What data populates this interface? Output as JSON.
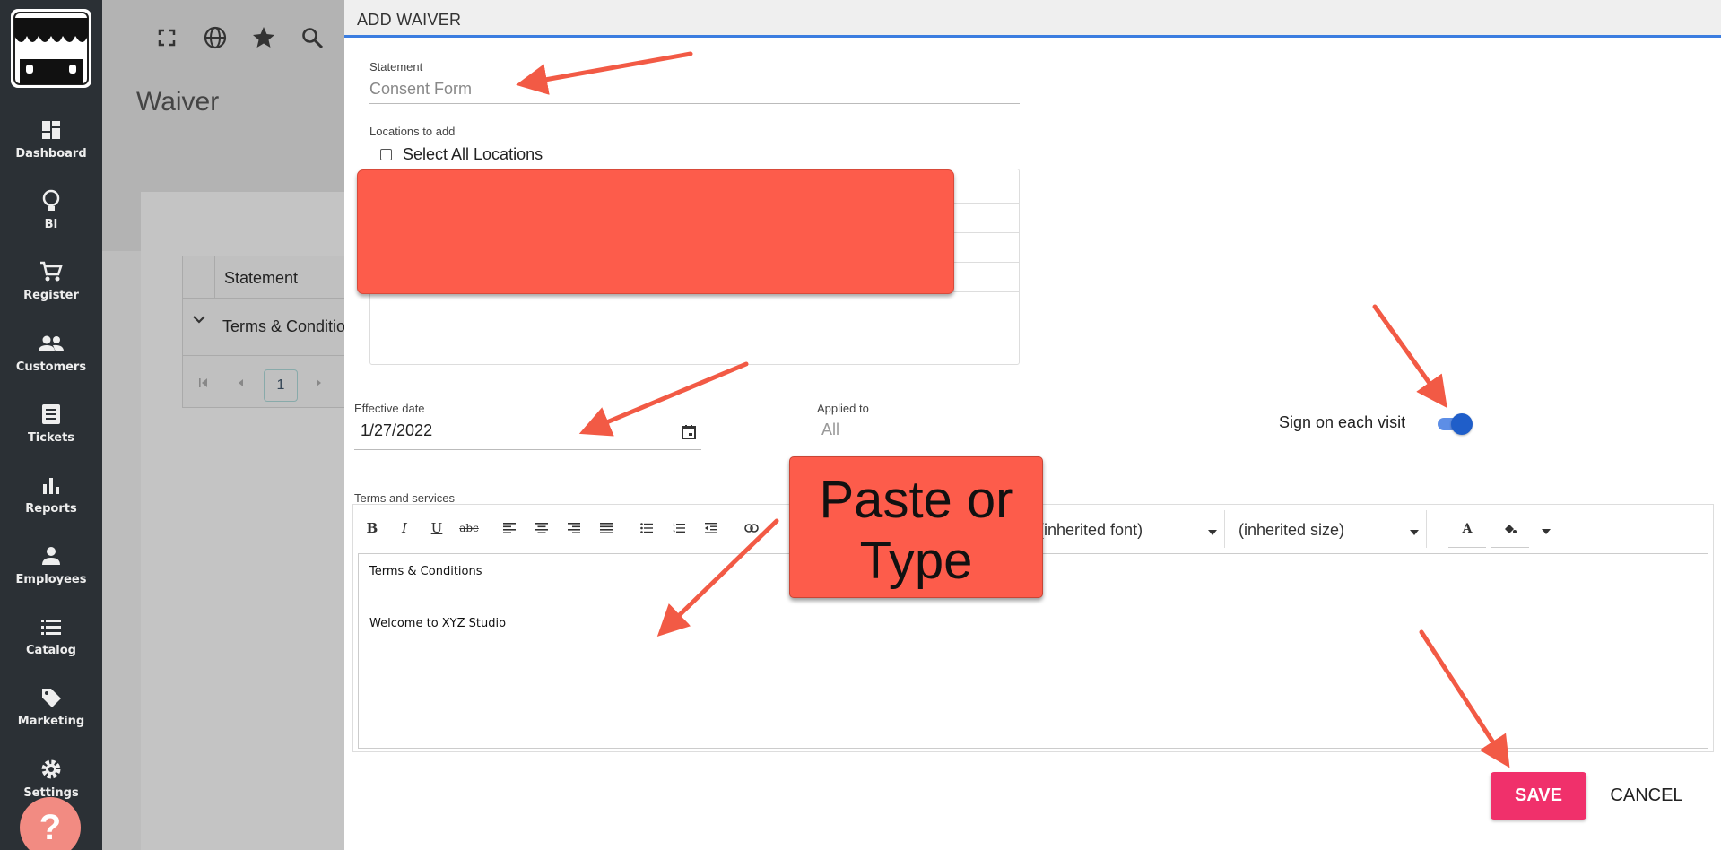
{
  "sidebar": {
    "items": [
      {
        "label": "Dashboard",
        "icon": "dashboard-icon"
      },
      {
        "label": "BI",
        "icon": "lightbulb-icon"
      },
      {
        "label": "Register",
        "icon": "cart-icon"
      },
      {
        "label": "Customers",
        "icon": "people-icon"
      },
      {
        "label": "Tickets",
        "icon": "ticket-icon"
      },
      {
        "label": "Reports",
        "icon": "bar-chart-icon"
      },
      {
        "label": "Employees",
        "icon": "person-icon"
      },
      {
        "label": "Catalog",
        "icon": "list-icon"
      },
      {
        "label": "Marketing",
        "icon": "tag-icon"
      },
      {
        "label": "Settings",
        "icon": "gear-icon"
      }
    ],
    "help_label": "?"
  },
  "background_page": {
    "title": "Waiver",
    "table": {
      "header": "Statement",
      "row": "Terms & Conditions"
    },
    "pager": {
      "page": "1"
    }
  },
  "dialog": {
    "title": "ADD WAIVER",
    "statement": {
      "label": "Statement",
      "value": "Consent Form"
    },
    "locations": {
      "label": "Locations to add",
      "select_all_label": "Select All Locations",
      "select_all_checked": false
    },
    "effective_date": {
      "label": "Effective date",
      "value": "1/27/2022"
    },
    "applied_to": {
      "label": "Applied to",
      "value": "All"
    },
    "sign_each_visit": {
      "label": "Sign on each visit",
      "enabled": true
    },
    "terms": {
      "label": "Terms and services",
      "font_select": "(inherited font)",
      "size_select": "(inherited size)",
      "content": [
        "Terms & Conditions",
        "Welcome to XYZ Studio"
      ]
    },
    "save_label": "SAVE",
    "cancel_label": "CANCEL"
  },
  "annotation": {
    "callout_line1": "Paste or",
    "callout_line2": "Type"
  },
  "colors": {
    "accent_blue": "#3b7de0",
    "save_pink": "#f0306b",
    "annotation_red": "#fd5c4b",
    "sidebar_bg": "#2b3035"
  }
}
